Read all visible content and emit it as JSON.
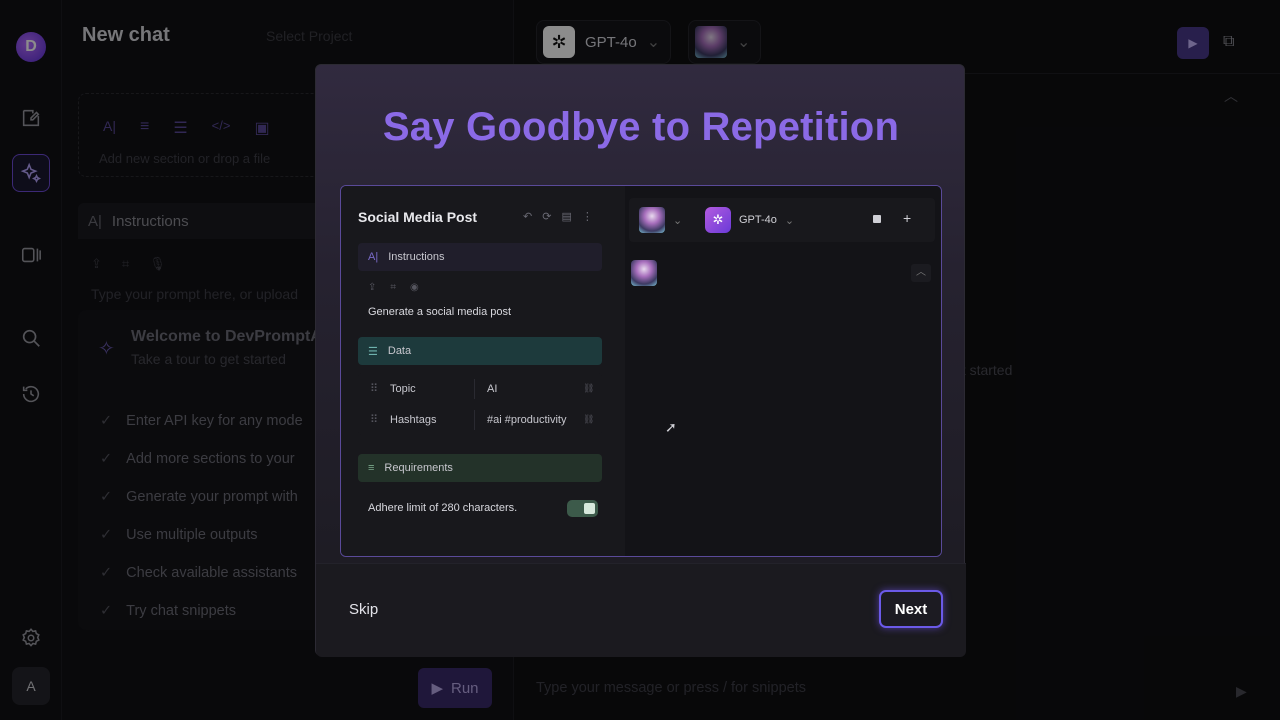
{
  "app": {
    "title": "New chat",
    "logo_letter": "D",
    "project_placeholder": "Select Project",
    "user_initial": "A"
  },
  "left_panel": {
    "drop_hint": "Add new section or drop a file",
    "instructions_label": "Instructions",
    "prompt_placeholder": "Type your prompt here, or upload",
    "welcome_title": "Welcome to DevPromptA",
    "welcome_subtitle": "Take a tour to get started",
    "tour_items": [
      "Enter API key for any mode",
      "Add more sections to your",
      "Generate your prompt with",
      "Use multiple outputs",
      "Check available assistants",
      "Try chat snippets"
    ],
    "run_label": "Run"
  },
  "right_area": {
    "model_name": "GPT-4o",
    "side_text": "et started",
    "message_placeholder": "Type your message or press / for snippets"
  },
  "modal": {
    "headline": "Say Goodbye to Repetition",
    "skip_label": "Skip",
    "next_label": "Next",
    "preview": {
      "title": "Social Media Post",
      "instructions_label": "Instructions",
      "instruction_text": "Generate a social media post",
      "data_label": "Data",
      "rows": [
        {
          "key": "Topic",
          "value": "AI"
        },
        {
          "key": "Hashtags",
          "value": "#ai #productivity"
        }
      ],
      "requirements_label": "Requirements",
      "requirement_text": "Adhere limit of 280 characters.",
      "requirement_enabled": true,
      "model_name": "GPT-4o"
    }
  },
  "colors": {
    "accent": "#8b6ae6",
    "next_border": "#6b5ae8",
    "data_block": "#1d3a3c",
    "requirements_block": "#233229"
  }
}
